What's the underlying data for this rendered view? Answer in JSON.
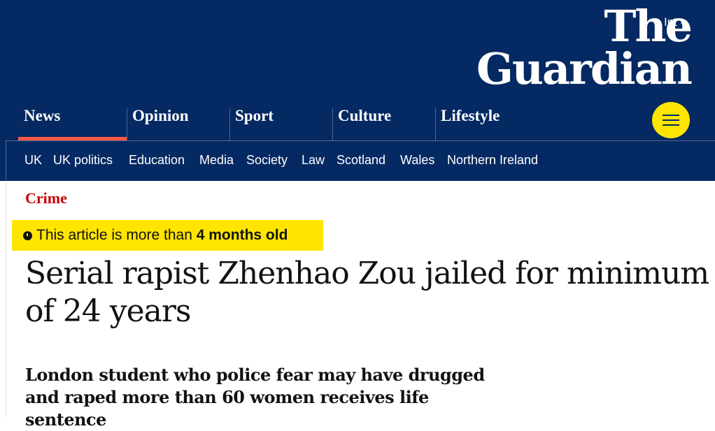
{
  "header": {
    "edition": "Int",
    "logo_line1": "The",
    "logo_line2": "Guardian",
    "colors": {
      "background": "#052962",
      "accent_news": "#ff5943",
      "menu_button": "#ffe500"
    }
  },
  "pillars": [
    {
      "label": "News",
      "active": true
    },
    {
      "label": "Opinion"
    },
    {
      "label": "Sport"
    },
    {
      "label": "Culture"
    },
    {
      "label": "Lifestyle"
    }
  ],
  "menu_icon": "hamburger-icon",
  "subnav": [
    "UK",
    "UK politics",
    "Education",
    "Media",
    "Society",
    "Law",
    "Scotland",
    "Wales",
    "Northern Ireland"
  ],
  "article": {
    "section": "Crime",
    "age_warning_prefix": "This article is more than ",
    "age_warning_value": "4 months old",
    "headline": "Serial rapist Zhenhao Zou jailed for minimum of 24 years",
    "standfirst": "London student who police fear may have drugged and raped more than 60 women receives life sentence",
    "colors": {
      "section": "#c70000",
      "age_warning_bg": "#ffe500"
    }
  }
}
